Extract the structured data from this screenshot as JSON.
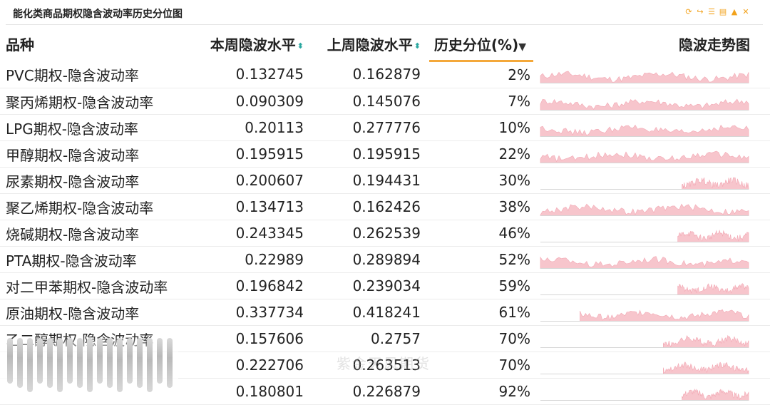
{
  "header": {
    "title": "能化类商品期权隐含波动率历史分位图",
    "tools": [
      {
        "icon": "refresh-icon",
        "glyph": "⟳"
      },
      {
        "icon": "share-icon",
        "glyph": "↪"
      },
      {
        "icon": "list-icon",
        "glyph": "☰"
      },
      {
        "icon": "document-icon",
        "glyph": "▤"
      },
      {
        "icon": "bell-icon",
        "glyph": "▲"
      },
      {
        "icon": "expand-icon",
        "glyph": "✕"
      }
    ]
  },
  "columns": {
    "name": "品种",
    "this_week": "本周隐波水平",
    "last_week": "上周隐波水平",
    "percentile": "历史分位(%)",
    "trend": "隐波走势图"
  },
  "sort_glyph": "⬍",
  "sort_active_glyph": "▼",
  "rows": [
    {
      "name": "PVC期权-隐含波动率",
      "this_week": "0.132745",
      "last_week": "0.162879",
      "percentile": "2%",
      "pct": 2,
      "start": 0.0
    },
    {
      "name": "聚丙烯期权-隐含波动率",
      "this_week": "0.090309",
      "last_week": "0.145076",
      "percentile": "7%",
      "pct": 7,
      "start": 0.0
    },
    {
      "name": "LPG期权-隐含波动率",
      "this_week": "0.20113",
      "last_week": "0.277776",
      "percentile": "10%",
      "pct": 10,
      "start": 0.0
    },
    {
      "name": "甲醇期权-隐含波动率",
      "this_week": "0.195915",
      "last_week": "0.195915",
      "percentile": "22%",
      "pct": 22,
      "start": 0.0
    },
    {
      "name": "尿素期权-隐含波动率",
      "this_week": "0.200607",
      "last_week": "0.194431",
      "percentile": "30%",
      "pct": 30,
      "start": 0.68
    },
    {
      "name": "聚乙烯期权-隐含波动率",
      "this_week": "0.134713",
      "last_week": "0.162426",
      "percentile": "38%",
      "pct": 38,
      "start": 0.0
    },
    {
      "name": "烧碱期权-隐含波动率",
      "this_week": "0.243345",
      "last_week": "0.262539",
      "percentile": "46%",
      "pct": 46,
      "start": 0.66
    },
    {
      "name": "PTA期权-隐含波动率",
      "this_week": "0.22989",
      "last_week": "0.289894",
      "percentile": "52%",
      "pct": 52,
      "start": 0.0
    },
    {
      "name": "对二甲苯期权-隐含波动率",
      "this_week": "0.196842",
      "last_week": "0.239034",
      "percentile": "59%",
      "pct": 59,
      "start": 0.66
    },
    {
      "name": "原油期权-隐含波动率",
      "this_week": "0.337734",
      "last_week": "0.418241",
      "percentile": "61%",
      "pct": 61,
      "start": 0.19
    },
    {
      "name": "乙二醇期权-隐含波动率",
      "this_week": "0.157606",
      "last_week": "0.2757",
      "percentile": "70%",
      "pct": 70,
      "start": 0.59
    },
    {
      "name": "",
      "this_week": "0.222706",
      "last_week": "0.263513",
      "percentile": "70%",
      "pct": 70,
      "start": 0.59
    },
    {
      "name": "",
      "this_week": "0.180801",
      "last_week": "0.226879",
      "percentile": "92%",
      "pct": 92,
      "start": 0.68
    }
  ],
  "watermark": "紫金天风期货",
  "colors": {
    "spark_fill": "#f7c5cc",
    "spark_line": "#f3a7b3",
    "accent": "#f4a83a",
    "sort": "#2aa7a0",
    "tool": "#f2a21b"
  }
}
